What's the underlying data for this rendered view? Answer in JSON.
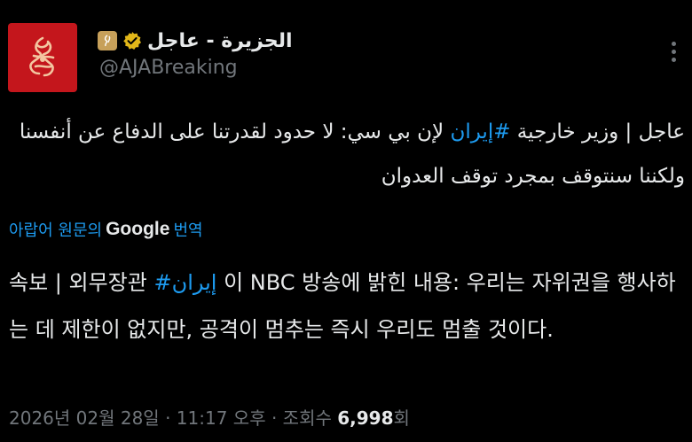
{
  "tweet": {
    "display_name": "الجزيرة - عاجل",
    "handle": "@AJABreaking",
    "original_text_prefix": "عاجل | وزير خارجية ",
    "original_hashtag": "#إيران",
    "original_text_suffix": " لإن بي سي: لا حدود لقدرتنا على الدفاع عن أنفسنا ولكننا سنتوقف بمجرد توقف العدوان",
    "translate_prefix": "아랍어 원문의 ",
    "translate_brand": "Google",
    "translate_suffix": " 번역",
    "translated_text_prefix": "속보 | 외무장관 ",
    "translated_hashtag": "#إيران",
    "translated_text_suffix": " 이 NBC 방송에 밝힌 내용: 우리는 자위권을 행사하는 데 제한이 없지만, 공격이 멈추는 즉시 우리도 멈출 것이다.",
    "date": "2026년 02월 28일",
    "separator1": " · ",
    "time": "11:17 오후",
    "separator2": " · ",
    "views_label": "조회수 ",
    "views_count": "6,998",
    "views_suffix": "회"
  },
  "colors": {
    "background": "#000000",
    "text": "#e7e9ea",
    "muted": "#71767b",
    "link": "#1d9bf0",
    "avatar": "#c4161c",
    "verified_gold": "#e2b719"
  },
  "icons": {
    "avatar": "al-jazeera-logo",
    "badge": "affiliate-badge-icon",
    "verified": "verified-gold-icon",
    "more": "more-options-icon"
  }
}
